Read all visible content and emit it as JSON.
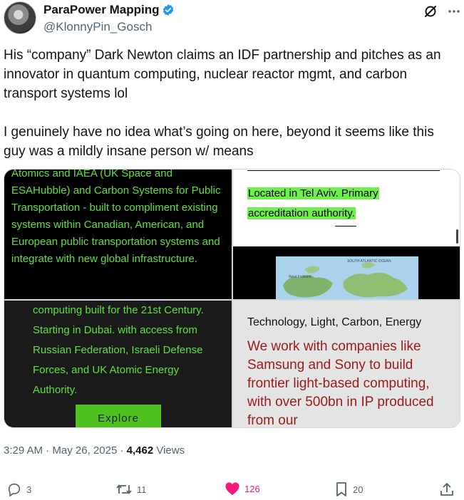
{
  "author": {
    "name": "ParaPower Mapping",
    "handle": "@KlonnyPin_Gosch"
  },
  "tweet": {
    "text": "His “company” Dark Newton claims an IDF partnership and pitches as an innovator in quantum computing, nuclear reactor mgmt, and carbon transport systems lol\n\nI genuinely have no idea what’s going on here, beyond it seems like this guy was a mildly insane person w/ means"
  },
  "media": {
    "img1_text": "Atomics and IAEA (UK Space and ESAHubble) and Carbon Systems for Public Transportation - built to compliment existing systems within Canadian, American, and European public transportation systems and integrate with new global infrastructure.",
    "img2_line1": "Located in Tel Aviv. Primary",
    "img2_line2": "accreditation authority.",
    "img2_map_label1": "SOUTH ATLANTIC OCEAN",
    "img2_map_label2": "West Falkland",
    "img3_text": "computing built for the 21st Century. Starting in Dubai.  with access from Russian Federation, Israeli Defense Forces, and UK Atomic Energy Authority.",
    "img3_button": "Explore",
    "img4_heading": "Technology, Light, Carbon, Energy",
    "img4_body": "We work with companies like Samsung and Sony to build frontier light-based computing, with over 500bn in IP produced from our"
  },
  "meta": {
    "time": "3:29 AM",
    "separator": " · ",
    "date": "May 26, 2025",
    "views_count": "4,462",
    "views_label": " Views"
  },
  "actions": {
    "replies": "3",
    "reposts": "11",
    "likes": "126",
    "bookmarks": "20"
  },
  "colors": {
    "like": "#f91880",
    "verified": "#1d9bf0",
    "neon_green": "#5fe03b",
    "dark_red": "#9b1a1a"
  }
}
